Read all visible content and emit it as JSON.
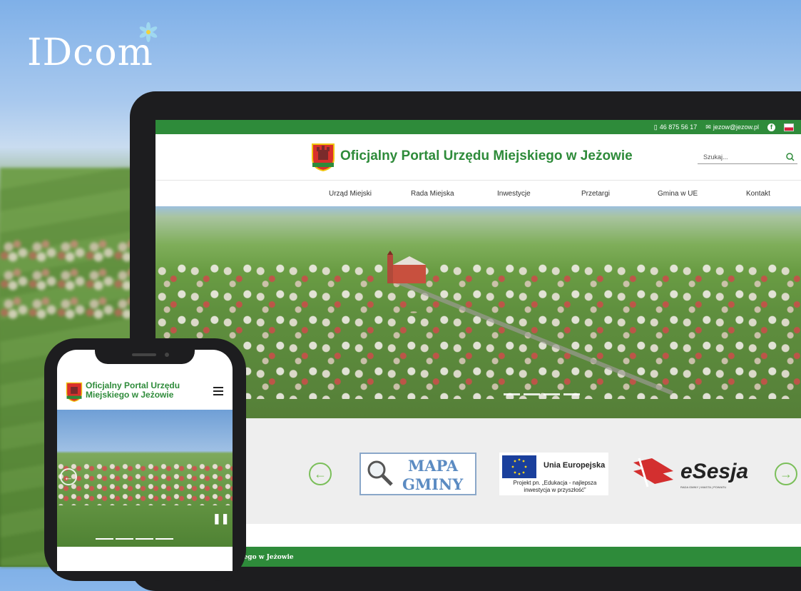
{
  "brand": {
    "name": "IDcom"
  },
  "tablet": {
    "topbar": {
      "phone": "46 875 56 17",
      "email": "jezow@jezow.pl",
      "facebook_icon": "f"
    },
    "header": {
      "title": "Oficjalny Portal Urzędu Miejskiego w Jeżowie",
      "search_placeholder": "Szukaj..."
    },
    "nav": [
      "Urząd Miejski",
      "Rada Miejska",
      "Inwestycje",
      "Przetargi",
      "Gmina w UE",
      "Kontakt"
    ],
    "hero_slides": 4,
    "links": {
      "prev": "←",
      "next": "→",
      "mapa_line1": "MAPA",
      "mapa_line2": "GMINY",
      "ue_name": "Unia Europejska",
      "ue_desc": "Projekt pn. „Edukacja - najlepsza inwestycja w przyszłość”",
      "esesja": "eSesja",
      "esesja_sub": "RADA GMINY | MIASTA | POWIATU"
    },
    "footer": "Oficjalny Portal Urzędu Miejskiego w Jeżowie"
  },
  "phone": {
    "title": "Oficjalny Portal Urzędu Miejskiego w Jeżowie",
    "prev": "←",
    "pause": "❚❚"
  },
  "colors": {
    "brand_green": "#2e8b3a",
    "accent_green": "#7bbf5a"
  }
}
